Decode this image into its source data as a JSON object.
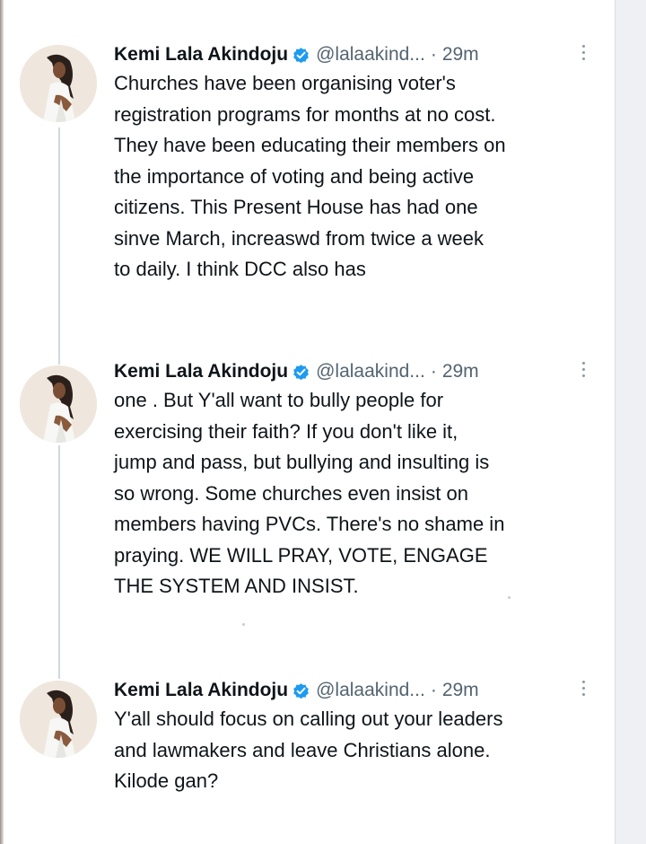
{
  "colors": {
    "text": "#0f1419",
    "secondary": "#536471",
    "verified_badge": "#1d9bf0",
    "thread_line": "#cfd9de",
    "side_panel": "#eef0f3"
  },
  "tweets": [
    {
      "name": "Kemi Lala Akindoju",
      "handle": "@lalaakind...",
      "separator": "·",
      "time": "29m",
      "lines": [
        "Churches have been organising voter's",
        "registration programs for months at no cost.",
        "They have been educating their members on",
        "the importance of voting and being active",
        "citizens.  This Present House has had one",
        "sinve March, increaswd from twice a week",
        "to daily. I think DCC also has"
      ]
    },
    {
      "name": "Kemi Lala Akindoju",
      "handle": "@lalaakind...",
      "separator": "·",
      "time": "29m",
      "lines": [
        "one . But Y'all want to bully people for",
        "exercising their faith? If you don't like it,",
        "jump and pass, but bullying and insulting is",
        "so wrong.  Some churches even insist on",
        "members having PVCs. There's no shame in",
        "praying.  WE WILL PRAY, VOTE, ENGAGE",
        "THE SYSTEM AND INSIST."
      ]
    },
    {
      "name": "Kemi Lala Akindoju",
      "handle": "@lalaakind...",
      "separator": "·",
      "time": "29m",
      "lines": [
        "Y'all should focus on calling out your leaders",
        "and lawmakers and leave Christians alone.",
        "Kilode gan?"
      ]
    }
  ]
}
